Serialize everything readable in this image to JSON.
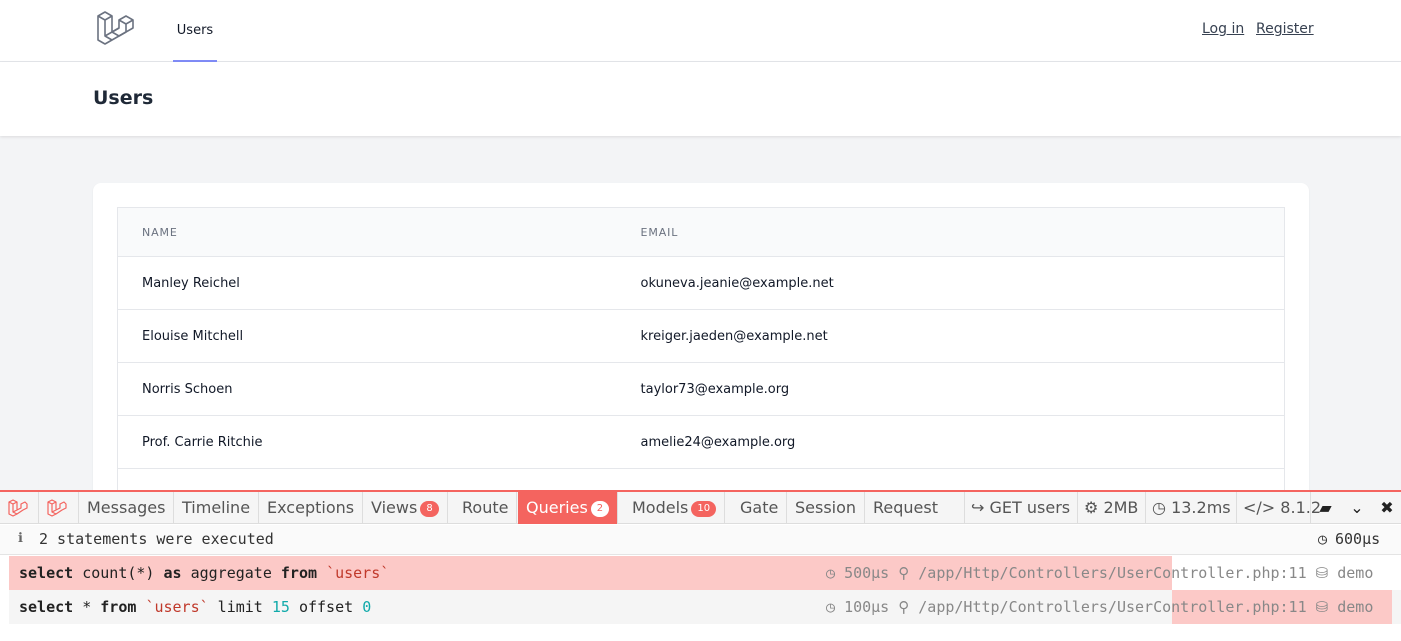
{
  "nav": {
    "link": "Users",
    "login": "Log in",
    "register": "Register"
  },
  "header": {
    "title": "Users"
  },
  "table": {
    "columns": [
      "NAME",
      "EMAIL"
    ],
    "rows": [
      {
        "name": "Manley Reichel",
        "email": "okuneva.jeanie@example.net"
      },
      {
        "name": "Elouise Mitchell",
        "email": "kreiger.jaeden@example.net"
      },
      {
        "name": "Norris Schoen",
        "email": "taylor73@example.org"
      },
      {
        "name": "Prof. Carrie Ritchie",
        "email": "amelie24@example.org"
      }
    ]
  },
  "debugbar": {
    "tabs": {
      "messages": "Messages",
      "timeline": "Timeline",
      "exceptions": "Exceptions",
      "views": "Views",
      "views_count": "8",
      "route": "Route",
      "queries": "Queries",
      "queries_count": "2",
      "models": "Models",
      "models_count": "10",
      "gate": "Gate",
      "session": "Session",
      "request": "Request"
    },
    "status": {
      "request": "GET users",
      "memory": "2MB",
      "time": "13.2ms",
      "php": "8.1.2"
    },
    "summary": {
      "text": "2 statements were executed",
      "total_time": "600μs"
    },
    "queries": [
      {
        "duration": "500μs",
        "source": "/app/Http/Controllers/UserController.php:11",
        "connection": "demo"
      },
      {
        "duration": "100μs",
        "source": "/app/Http/Controllers/UserController.php:11",
        "connection": "demo"
      }
    ],
    "colors": {
      "accent": "#f4645f",
      "highlight": "#fcc9c7"
    }
  }
}
